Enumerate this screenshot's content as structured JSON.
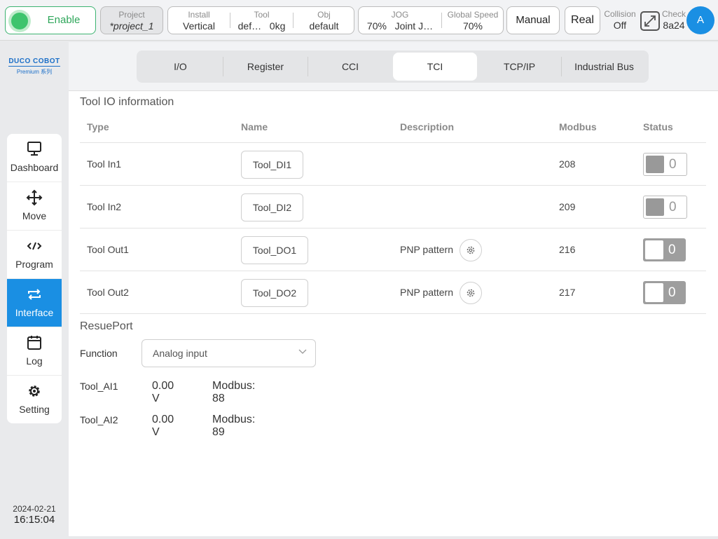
{
  "topbar": {
    "enable_label": "Enable",
    "project": {
      "title": "Project",
      "value": "*project_1"
    },
    "install": {
      "title": "Install",
      "value": "Vertical"
    },
    "tool": {
      "title": "Tool",
      "value_name": "def…",
      "value_load": "0kg"
    },
    "obj": {
      "title": "Obj",
      "value": "default"
    },
    "jog": {
      "title": "JOG",
      "value_speed": "70%",
      "value_mode": "Joint J…"
    },
    "global_speed": {
      "title": "Global Speed",
      "value": "70%"
    },
    "mode_label": "Manual",
    "real_label": "Real",
    "collision": {
      "title": "Collision",
      "value": "Off"
    },
    "check": {
      "title": "Check",
      "value": "8a24"
    },
    "avatar_letter": "A",
    "icons": {
      "expand": "expand-icon",
      "enable": "status-dot-icon"
    },
    "colors": {
      "enable_green": "#3ec46d",
      "accent_blue": "#1a8fe3"
    }
  },
  "sidebar": {
    "logo_brand": "DUCO COBOT",
    "logo_sub": "Premium 系列",
    "items": [
      {
        "label": "Dashboard",
        "icon": "monitor-icon"
      },
      {
        "label": "Move",
        "icon": "move-arrows-icon"
      },
      {
        "label": "Program",
        "icon": "code-icon"
      },
      {
        "label": "Interface",
        "icon": "swap-arrows-icon"
      },
      {
        "label": "Log",
        "icon": "calendar-icon"
      },
      {
        "label": "Setting",
        "icon": "gear-icon"
      }
    ],
    "active_item": "Interface",
    "date": "2024-02-21",
    "time": "16:15:04"
  },
  "tabs": {
    "items": [
      "I/O",
      "Register",
      "CCI",
      "TCI",
      "TCP/IP",
      "Industrial Bus"
    ],
    "active": "TCI"
  },
  "tool_io": {
    "title": "Tool IO information",
    "headers": {
      "type": "Type",
      "name": "Name",
      "description": "Description",
      "modbus": "Modbus",
      "status": "Status"
    },
    "rows": [
      {
        "type": "Tool In1",
        "name": "Tool_DI1",
        "description": "",
        "modbus": "208",
        "status": "0"
      },
      {
        "type": "Tool In2",
        "name": "Tool_DI2",
        "description": "",
        "modbus": "209",
        "status": "0"
      },
      {
        "type": "Tool Out1",
        "name": "Tool_DO1",
        "description": "PNP pattern",
        "modbus": "216",
        "status": "0"
      },
      {
        "type": "Tool Out2",
        "name": "Tool_DO2",
        "description": "PNP pattern",
        "modbus": "217",
        "status": "0"
      }
    ]
  },
  "resue_port": {
    "title": "ResuePort",
    "function_label": "Function",
    "function_value": "Analog input",
    "analog": [
      {
        "name": "Tool_AI1",
        "value": "0.00 V",
        "modbus": "Modbus: 88"
      },
      {
        "name": "Tool_AI2",
        "value": "0.00 V",
        "modbus": "Modbus: 89"
      }
    ]
  }
}
